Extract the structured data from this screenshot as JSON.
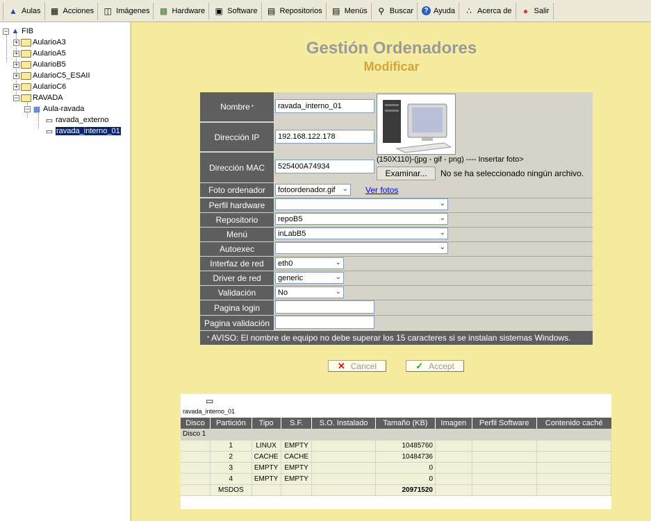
{
  "toolbar": {
    "items": [
      {
        "label": "Aulas",
        "icon": "classrooms-icon"
      },
      {
        "label": "Acciones",
        "icon": "actions-icon"
      },
      {
        "label": "Imágenes",
        "icon": "images-icon"
      },
      {
        "label": "Hardware",
        "icon": "hardware-icon"
      },
      {
        "label": "Software",
        "icon": "software-icon"
      },
      {
        "label": "Repositorios",
        "icon": "repositories-icon"
      },
      {
        "label": "Menús",
        "icon": "menus-icon"
      },
      {
        "label": "Buscar",
        "icon": "search-icon"
      },
      {
        "label": "Ayuda",
        "icon": "help-icon"
      },
      {
        "label": "Acerca de",
        "icon": "about-icon"
      },
      {
        "label": "Salir",
        "icon": "exit-icon"
      }
    ]
  },
  "tree": {
    "root": "FIB",
    "aulas": [
      "AularioA3",
      "AularioA5",
      "AularioB5",
      "AularioC5_ESAII",
      "AularioC6",
      "RAVADA"
    ],
    "aula": "Aula-ravada",
    "computers": [
      "ravada_externo",
      "ravada_interno_01"
    ]
  },
  "header": {
    "title": "Gestión Ordenadores",
    "subtitle": "Modificar"
  },
  "form": {
    "nombre_label": "Nombre",
    "nombre_required": "*",
    "nombre_value": "ravada_interno_01",
    "ip_label": "Dirección IP",
    "ip_value": "192.168.122.178",
    "mac_label": "Dirección MAC",
    "mac_value": "525400A74934",
    "photo_hint": "(150X110)-(jpg - gif - png) ---- Insertar foto>",
    "browse_label": "Examinar...",
    "no_file": "No se ha seleccionado ningún archivo.",
    "foto_label": "Foto ordenador",
    "foto_value": "fotoordenador.gif",
    "ver_fotos": "Ver fotos",
    "perfil_label": "Perfil hardware",
    "perfil_value": "",
    "repo_label": "Repositorio",
    "repo_value": "repoB5",
    "menu_label": "Menú",
    "menu_value": "inLabB5",
    "autoexec_label": "Autoexec",
    "autoexec_value": "",
    "iface_label": "Interfaz de red",
    "iface_value": "eth0",
    "driver_label": "Driver de red",
    "driver_value": "generic",
    "valid_label": "Validación",
    "valid_value": "No",
    "login_label": "Pagina login",
    "login_value": "",
    "pvalid_label": "Pagina validación",
    "pvalid_value": "",
    "aviso_mark": "*",
    "aviso": "AVISO: El nombre de equipo no debe superar los 15 caracteres si se instalan sistemas Windows."
  },
  "actions": {
    "cancel": "Cancel",
    "accept": "Accept"
  },
  "disk": {
    "computer": "ravada_interno_01",
    "columns": [
      "Disco",
      "Partición",
      "Tipo",
      "S.F.",
      "S.O. Instalado",
      "Tamaño (KB)",
      "Imagen",
      "Perfil Software",
      "Contenido caché"
    ],
    "disk_label": "Disco 1",
    "rows": [
      {
        "part": "1",
        "tipo": "LINUX",
        "sf": "EMPTY",
        "so": "",
        "size": "10485760"
      },
      {
        "part": "2",
        "tipo": "CACHE",
        "sf": "CACHE",
        "so": "",
        "size": "10484736"
      },
      {
        "part": "3",
        "tipo": "EMPTY",
        "sf": "EMPTY",
        "so": "",
        "size": "0"
      },
      {
        "part": "4",
        "tipo": "EMPTY",
        "sf": "EMPTY",
        "so": "",
        "size": "0"
      }
    ],
    "total_label": "MSDOS",
    "total_size": "20971520"
  }
}
